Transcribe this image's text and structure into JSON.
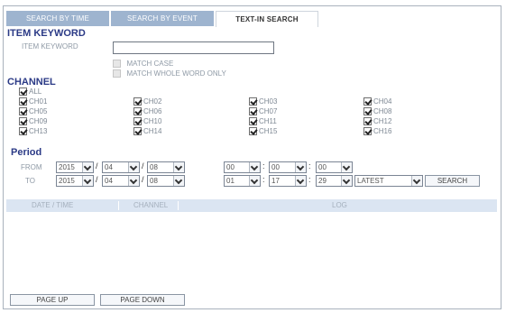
{
  "tabs": [
    {
      "label": "SEARCH BY TIME"
    },
    {
      "label": "SEARCH BY EVENT"
    },
    {
      "label": "TEXT-IN SEARCH"
    }
  ],
  "item_keyword": {
    "heading": "ITEM KEYWORD",
    "field_label": "ITEM KEYWORD",
    "value": "",
    "match_case": "MATCH CASE",
    "match_whole": "MATCH WHOLE WORD ONLY"
  },
  "channel": {
    "heading": "CHANNEL",
    "all_label": "ALL",
    "channels": [
      "CH01",
      "CH02",
      "CH03",
      "CH04",
      "CH05",
      "CH06",
      "CH07",
      "CH08",
      "CH09",
      "CH10",
      "CH11",
      "CH12",
      "CH13",
      "CH14",
      "CH15",
      "CH16"
    ]
  },
  "period": {
    "heading": "Period",
    "from_label": "FROM",
    "to_label": "TO",
    "from": {
      "year": "2015",
      "month": "04",
      "day": "08",
      "hour": "00",
      "minute": "00",
      "second": "00"
    },
    "to": {
      "year": "2015",
      "month": "04",
      "day": "08",
      "hour": "01",
      "minute": "17",
      "second": "29"
    },
    "order": "LATEST",
    "search_label": "SEARCH"
  },
  "log_table": {
    "col_datetime": "DATE / TIME",
    "col_channel": "CHANNEL",
    "col_log": "LOG"
  },
  "buttons": {
    "page_up": "PAGE UP",
    "page_down": "PAGE DOWN"
  }
}
